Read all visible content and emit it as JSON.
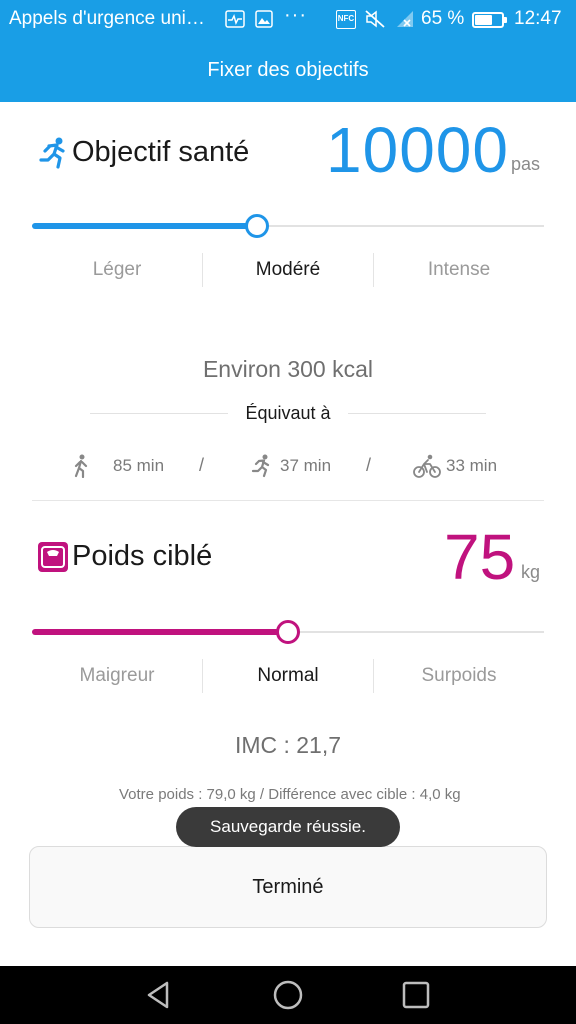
{
  "status_bar": {
    "app_name": "Appels d'urgence uni…",
    "nfc_label": "NFC",
    "overflow": "···",
    "battery_percent": "65 %",
    "battery_level": 0.65,
    "time": "12:47"
  },
  "app_bar": {
    "title": "Fixer des objectifs"
  },
  "health_goal": {
    "title": "Objectif santé",
    "value": "10000",
    "unit": "pas",
    "slider_fraction": 0.44,
    "accent_color": "#1f95e8",
    "levels": [
      "Léger",
      "Modéré",
      "Intense"
    ],
    "selected_level": "Modéré",
    "kcal_text": "Environ  300 kcal",
    "equivalent_label": "Équivaut à",
    "equivalents": [
      {
        "icon": "walk-icon",
        "text": "85 min"
      },
      {
        "icon": "run-icon",
        "text": "37 min"
      },
      {
        "icon": "bike-icon",
        "text": "33 min"
      }
    ],
    "separator": "/"
  },
  "weight_goal": {
    "title": "Poids ciblé",
    "value": "75",
    "unit": "kg",
    "slider_fraction": 0.5,
    "accent_color": "#c0127e",
    "levels": [
      "Maigreur",
      "Normal",
      "Surpoids"
    ],
    "selected_level": "Normal",
    "bmi_text": "IMC : 21,7",
    "detail_text": "Votre poids : 79,0 kg / Différence avec cible : 4,0 kg"
  },
  "toast": {
    "text": "Sauvegarde réussie."
  },
  "done_button": {
    "label": "Terminé"
  },
  "nav_bar": {
    "icons": [
      "back-icon",
      "home-icon",
      "recents-icon"
    ]
  }
}
